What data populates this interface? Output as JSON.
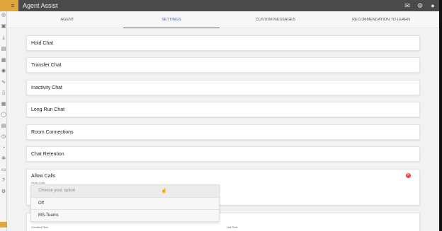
{
  "app": {
    "title": "Agent Assist"
  },
  "tabs": [
    {
      "label": "AGENT",
      "active": false
    },
    {
      "label": "SETTINGS",
      "active": true
    },
    {
      "label": "CUSTOM MESSAGES",
      "active": false
    },
    {
      "label": "RECOMMENDATION TO LEARN",
      "active": false
    }
  ],
  "sections": [
    {
      "label": "Hold Chat"
    },
    {
      "label": "Transfer Chat"
    },
    {
      "label": "Inactivity Chat"
    },
    {
      "label": "Long Run Chat"
    },
    {
      "label": "Room Connections"
    },
    {
      "label": "Chat Retention"
    }
  ],
  "allow_calls": {
    "label": "Allow Calls",
    "field_label": "Allow Calls",
    "placeholder": "Choose your option",
    "options": [
      "Off",
      "MS-Teams"
    ]
  },
  "footer": {
    "left_label": "Creation Rule",
    "right_label": "List Rule"
  },
  "colors": {
    "accent": "#4a5fb0",
    "brand": "#e0a53b",
    "close": "#e64545",
    "topbar": "#4a4a4a"
  },
  "icons": {
    "menu": "hamburger-icon",
    "topbar": [
      "mail-icon",
      "gear-icon",
      "user-icon"
    ],
    "close": "close-icon",
    "cursor": "pointer-cursor-icon"
  }
}
